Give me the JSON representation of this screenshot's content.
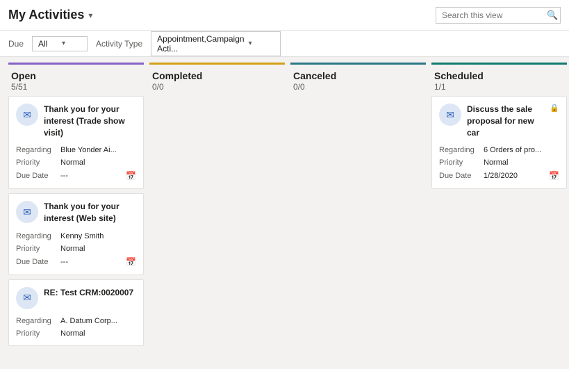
{
  "header": {
    "title": "My Activities",
    "chevron": "▾",
    "search_placeholder": "Search this view",
    "search_icon": "🔍"
  },
  "toolbar": {
    "due_label": "Due",
    "due_value": "All",
    "activity_type_label": "Activity Type",
    "activity_type_value": "Appointment,Campaign Acti..."
  },
  "columns": [
    {
      "id": "open",
      "title": "Open",
      "count": "5/51",
      "color_class": "open-col",
      "cards": [
        {
          "icon": "✉",
          "title": "Thank you for your interest (Trade show visit)",
          "fields": [
            {
              "label": "Regarding",
              "value": "Blue Yonder Ai..."
            },
            {
              "label": "Priority",
              "value": "Normal"
            },
            {
              "label": "Due Date",
              "value": "---",
              "has_calendar": true
            }
          ]
        },
        {
          "icon": "✉",
          "title": "Thank you for your interest (Web site)",
          "fields": [
            {
              "label": "Regarding",
              "value": "Kenny Smith"
            },
            {
              "label": "Priority",
              "value": "Normal"
            },
            {
              "label": "Due Date",
              "value": "---",
              "has_calendar": true
            }
          ]
        },
        {
          "icon": "✉",
          "title": "RE: Test CRM:0020007",
          "fields": [
            {
              "label": "Regarding",
              "value": "A. Datum Corp..."
            },
            {
              "label": "Priority",
              "value": "Normal"
            }
          ]
        }
      ]
    },
    {
      "id": "completed",
      "title": "Completed",
      "count": "0/0",
      "color_class": "completed-col",
      "cards": []
    },
    {
      "id": "canceled",
      "title": "Canceled",
      "count": "0/0",
      "color_class": "canceled-col",
      "cards": []
    },
    {
      "id": "scheduled",
      "title": "Scheduled",
      "count": "1/1",
      "color_class": "scheduled-col",
      "cards": [
        {
          "icon": "✉",
          "title": "Discuss the sale proposal for new car",
          "has_lock": true,
          "fields": [
            {
              "label": "Regarding",
              "value": "6 Orders of pro..."
            },
            {
              "label": "Priority",
              "value": "Normal"
            },
            {
              "label": "Due Date",
              "value": "1/28/2020",
              "has_calendar": true
            }
          ]
        }
      ]
    }
  ]
}
